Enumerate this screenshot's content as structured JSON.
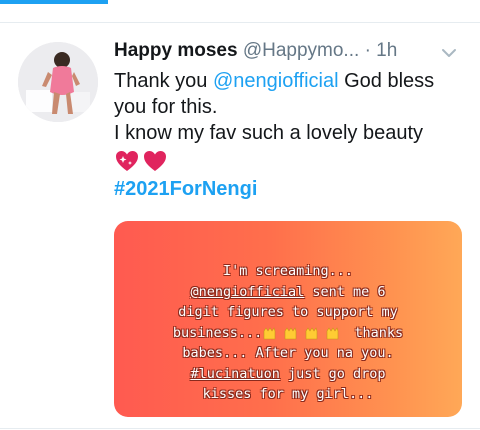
{
  "tweet": {
    "author_name": "Happy moses",
    "author_handle": "@Happymo...",
    "separator": "·",
    "time": "1h",
    "line1_prefix": "Thank you ",
    "line1_mention": "@nengiofficial",
    "line1_suffix": " God bless",
    "line2": "you for this.",
    "line3": "I know my fav such a lovely beauty",
    "emojis": [
      "sparkling-heart",
      "red-heart"
    ],
    "hashtag": "#2021ForNengi"
  },
  "story": {
    "line1": "I'm screaming...",
    "line2_mention": "@nengiofficial",
    "line2_rest": " sent me 6",
    "line3": "digit figures to support my",
    "line4_prefix": "business...",
    "line4_suffix": " thanks",
    "line5": "babes... After you na you.",
    "line6_hashtag": "#lucinatuon",
    "line6_rest": " just go drop",
    "line7": "kisses for my girl...",
    "colors": {
      "gradient_start": "#ff5a50",
      "gradient_end": "#ffa857"
    }
  },
  "colors": {
    "accent": "#1da1f2",
    "muted": "#657786"
  }
}
